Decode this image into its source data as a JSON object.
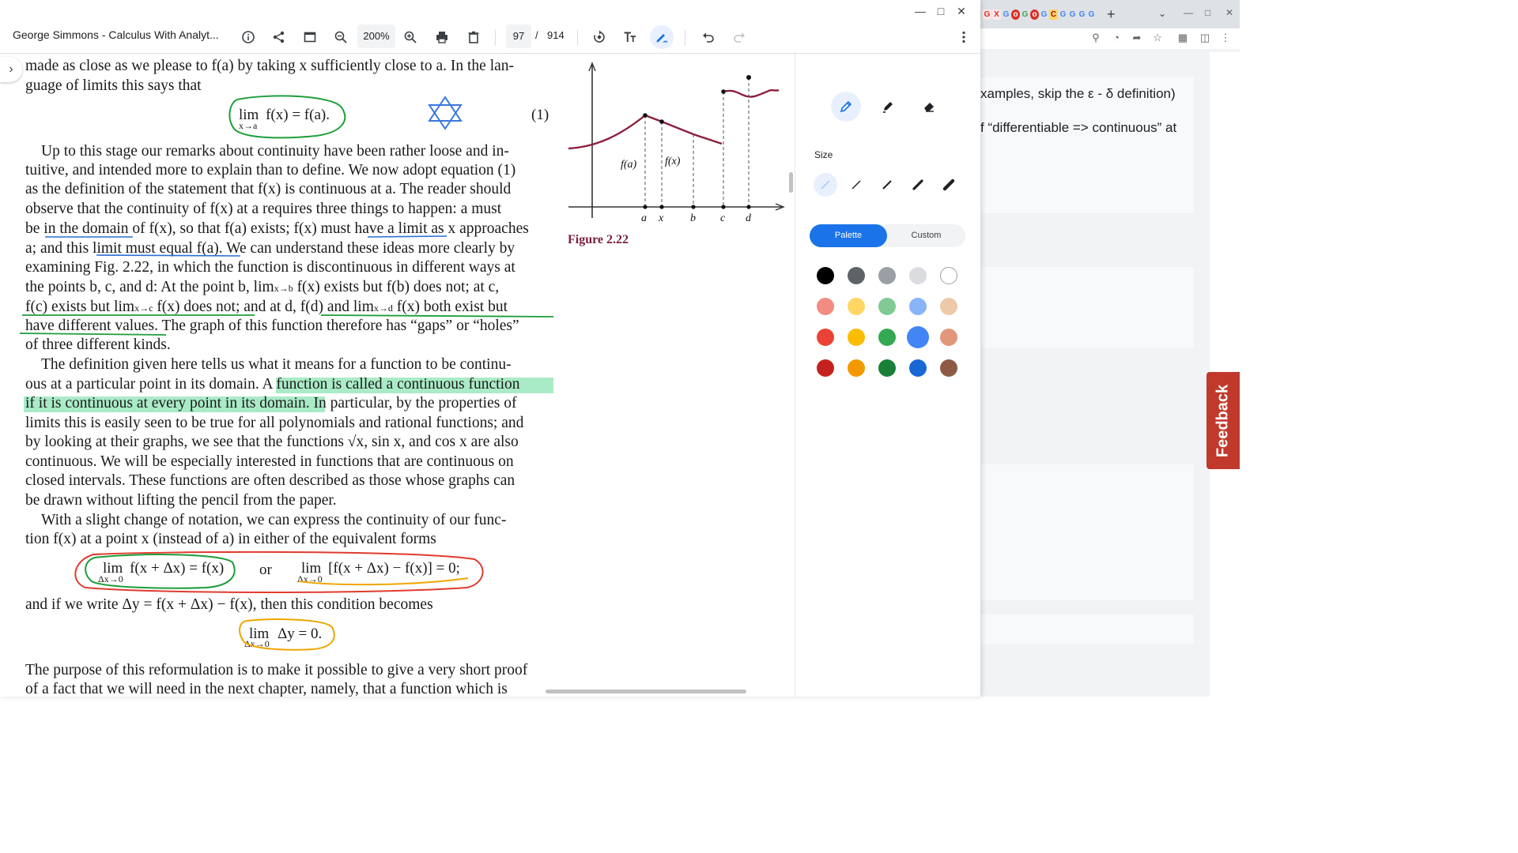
{
  "viewer": {
    "title": "George Simmons - Calculus With Analyt...",
    "zoom": "200%",
    "page_current": "97",
    "page_separator": "/",
    "page_total": "914"
  },
  "document": {
    "lines": [
      "made as close as we please to f(a) by taking x sufficiently close to a. In the lan-",
      "guage of limits this says that",
      "Up to this stage our remarks about continuity have been rather loose and in-",
      "tuitive, and intended more to explain than to define. We now adopt equation (1)",
      "as the definition of the statement that f(x) is continuous at a. The reader should",
      "observe that the continuity of f(x) at a requires three things to happen: a must",
      "be in the domain of f(x), so that f(a) exists; f(x) must have a limit as x approaches",
      "a; and this limit must equal f(a). We can understand these ideas more clearly by",
      "examining Fig. 2.22, in which the function is discontinuous in different ways at",
      "the points b, c, and d: At the point b, lim",
      "f(c) exists but lim",
      "have different values. The graph of this function therefore has “gaps” or “holes”",
      "of three different kinds.",
      "The definition given here tells us what it means for a function to be continu-",
      "ous at a particular point in its domain. A function is called a continuous function",
      "if it is continuous at every point in its domain. In particular, by the properties of",
      "limits this is easily seen to be true for all polynomials and rational functions; and",
      "by looking at their graphs, we see that the functions √x, sin x, and cos x are also",
      "continuous. We will be especially interested in functions that are continuous on",
      "closed intervals. These functions are often described as those whose graphs can",
      "be drawn without lifting the pencil from the paper.",
      "With a slight change of notation, we can express the continuity of our func-",
      "tion f(x) at a point x (instead of a) in either of the equivalent forms",
      "and if we write Δy = f(x + Δx) − f(x), then this condition becomes",
      "The purpose of this reformulation is to make it possible to give a very short proof",
      "of a fact that we will need in the next chapter, namely, that a function which is"
    ],
    "line9_tail": "f(x) exists but f(b) does not; at c,",
    "line10_tail": "f(x) does not; and at d, f(d) and lim",
    "line10_end": "f(x) both exist but",
    "sub_b": "x→b",
    "sub_c": "x→c",
    "sub_d": "x→d",
    "eq1": {
      "lim": "lim",
      "sub": "x→a",
      "body": "f(x) = f(a).",
      "number": "(1)"
    },
    "eq2": {
      "lim_left": "lim",
      "sub_left": "Δx→0",
      "body_left": "f(x + Δx) = f(x)",
      "or": "or",
      "lim_right": "lim",
      "sub_right": "Δx→0",
      "body_right": "[f(x + Δx) − f(x)] = 0;"
    },
    "eq3": {
      "lim": "lim",
      "sub": "Δx→0",
      "body": "Δy = 0."
    },
    "figure": {
      "caption": "Figure 2.22",
      "label_fa": "f(a)",
      "label_fx": "f(x)",
      "axis_labels": [
        "a",
        "x",
        "b",
        "c",
        "d"
      ]
    }
  },
  "panel": {
    "size_label": "Size",
    "segment_palette": "Palette",
    "segment_custom": "Custom",
    "palette": [
      [
        "#000000",
        "#5f6368",
        "#9aa0a6",
        "#dadce0",
        "#ffffff"
      ],
      [
        "#f28b82",
        "#fdd663",
        "#81c995",
        "#8ab4f8",
        "#eec9a9"
      ],
      [
        "#ea4335",
        "#fbbc04",
        "#34a853",
        "#4285f4",
        "#e2967a"
      ],
      [
        "#c5221f",
        "#f29900",
        "#188038",
        "#1967d2",
        "#8d5b45"
      ]
    ],
    "selected_color": "#4285f4"
  },
  "background_page": {
    "text_1": "xamples, skip the ε - δ definition)",
    "text_2": "f “differentiable => continuous” at",
    "feedback": "Feedback"
  }
}
